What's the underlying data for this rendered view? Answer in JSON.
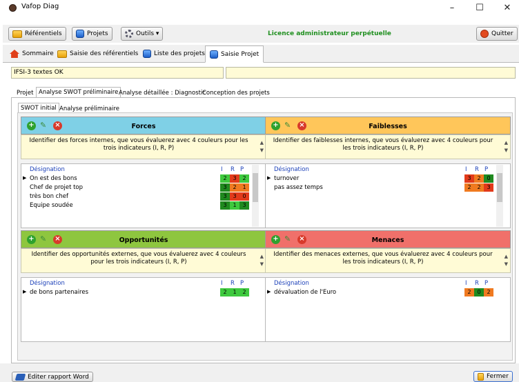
{
  "window": {
    "title": "Vafop Diag",
    "controls": [
      "–",
      "☐",
      "✕"
    ]
  },
  "toolbar": {
    "referentiels": "Référentiels",
    "projets": "Projets",
    "outils": "Outils ▾",
    "licence": "Licence administrateur perpétuelle",
    "quitter": "Quitter"
  },
  "main_tabs": [
    {
      "label": "Sommaire",
      "icon": "house-icon"
    },
    {
      "label": "Saisie des référentiels",
      "icon": "folder-icon"
    },
    {
      "label": "Liste des projets",
      "icon": "database-icon"
    },
    {
      "label": "Saisie Projet",
      "icon": "database-icon",
      "active": true
    }
  ],
  "project": {
    "name": "IFSI-3 textes OK",
    "secondary": ""
  },
  "sub_tabs": [
    "Projet",
    "Analyse SWOT préliminaire",
    "Analyse détaillée : Diagnostic",
    "Conception des projets"
  ],
  "swot_tabs": [
    "SWOT initial",
    "Analyse préliminaire"
  ],
  "grid_headers": {
    "designation": "Désignation",
    "i": "I",
    "r": "R",
    "p": "P"
  },
  "colors": {
    "forces": "#7fd0e6",
    "faiblesses": "#ffc65a",
    "opportunites": "#8ec63f",
    "menaces": "#f0706a",
    "score_3": "#1f9a1f",
    "score_2": "#4fd04f",
    "score_2_orange": "#f07a20",
    "score_1": "#e63a1f",
    "score_0": "#1f8f1f"
  },
  "quadrants": {
    "forces": {
      "title": "Forces",
      "desc": "Identifier des forces internes, que vous évaluerez avec 4 couleurs pour les trois indicateurs (I, R, P)",
      "rows": [
        {
          "label": "On est  des  bons",
          "i": "2",
          "r": "3",
          "p": "2",
          "ic": "#3ec93e",
          "rc": "#e23a1a",
          "pc": "#3ec93e"
        },
        {
          "label": "Chef de projet top",
          "i": "3",
          "r": "2",
          "p": "1",
          "ic": "#1f8a1f",
          "rc": "#f07a20",
          "pc": "#f07a20"
        },
        {
          "label": "très bon chef",
          "i": "3",
          "r": "3",
          "p": "0",
          "ic": "#1f8a1f",
          "rc": "#e23a1a",
          "pc": "#e23a1a"
        },
        {
          "label": "Equipe soudée",
          "i": "3",
          "r": "1",
          "p": "3",
          "ic": "#1f8a1f",
          "rc": "#3ec93e",
          "pc": "#1f8a1f"
        }
      ]
    },
    "faiblesses": {
      "title": "Faiblesses",
      "desc": "Identifier des faiblesses internes, que vous évaluerez avec 4 couleurs pour les trois indicateurs (I, R, P)",
      "rows": [
        {
          "label": "turnover",
          "i": "3",
          "r": "2",
          "p": "0",
          "ic": "#e23a1a",
          "rc": "#f07a20",
          "pc": "#1f8a1f"
        },
        {
          "label": "pas assez temps",
          "i": "2",
          "r": "2",
          "p": "3",
          "ic": "#f07a20",
          "rc": "#f07a20",
          "pc": "#e23a1a"
        }
      ]
    },
    "opportunites": {
      "title": "Opportunités",
      "desc": "Identifier des opportunités externes, que vous évaluerez avec 4 couleurs pour les trois indicateurs (I, R, P)",
      "rows": [
        {
          "label": "de bons partenaires",
          "i": "2",
          "r": "1",
          "p": "2",
          "ic": "#3ec93e",
          "rc": "#3ec93e",
          "pc": "#3ec93e"
        }
      ]
    },
    "menaces": {
      "title": "Menaces",
      "desc": "Identifier des menaces externes, que vous évaluerez avec 4 couleurs pour les trois indicateurs (I, R, P)",
      "rows": [
        {
          "label": "dévaluation de l'Euro",
          "i": "2",
          "r": "0",
          "p": "2",
          "ic": "#f07a20",
          "rc": "#1f8a1f",
          "pc": "#f07a20"
        }
      ]
    }
  },
  "bottom": {
    "word": "Editer rapport Word",
    "fermer": "Fermer"
  }
}
